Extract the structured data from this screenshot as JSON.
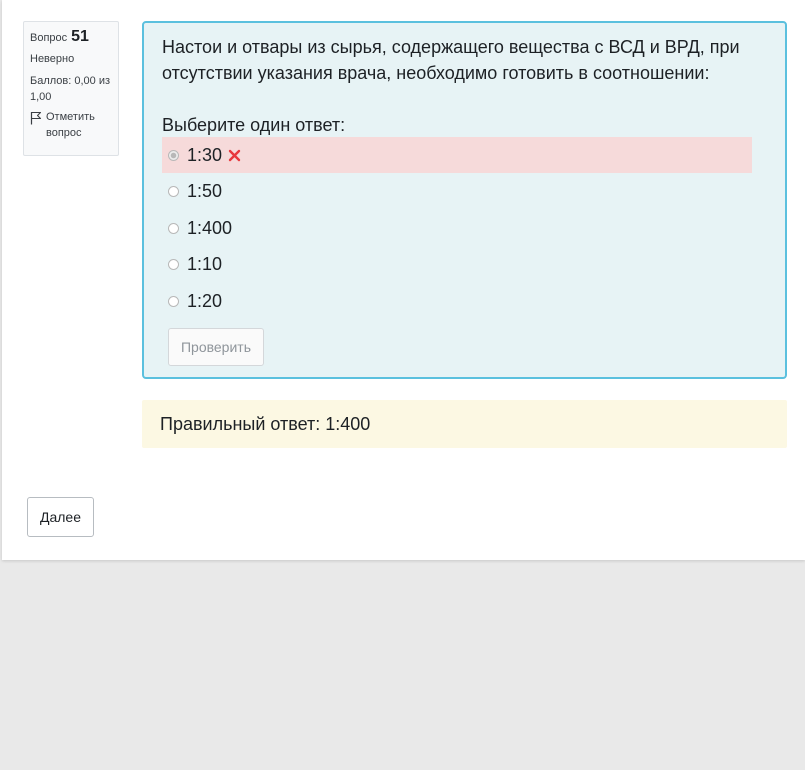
{
  "question_info": {
    "label": "Вопрос",
    "number": "51",
    "state": "Неверно",
    "grade": "Баллов: 0,00 из 1,00",
    "flag_label": "Отметить вопрос"
  },
  "question": {
    "text": "Настои и отвары из сырья, содержащего вещества с ВСД и ВРД, при отсутствии указания врача, необходимо готовить в соотношении:",
    "prompt": "Выберите один ответ:",
    "answers": [
      {
        "label": "1:30",
        "selected": true,
        "incorrect": true
      },
      {
        "label": "1:50",
        "selected": false
      },
      {
        "label": "1:400",
        "selected": false
      },
      {
        "label": "1:10",
        "selected": false
      },
      {
        "label": "1:20",
        "selected": false
      }
    ],
    "check_button": "Проверить"
  },
  "feedback": {
    "right_answer": "Правильный ответ: 1:400"
  },
  "navigation": {
    "next_button": "Далее"
  },
  "colors": {
    "question_bg": "#e7f3f5",
    "question_border": "#5bc0de",
    "incorrect_bg": "#f6dada",
    "incorrect_mark": "#e8383d",
    "feedback_bg": "#fcf8e3"
  }
}
